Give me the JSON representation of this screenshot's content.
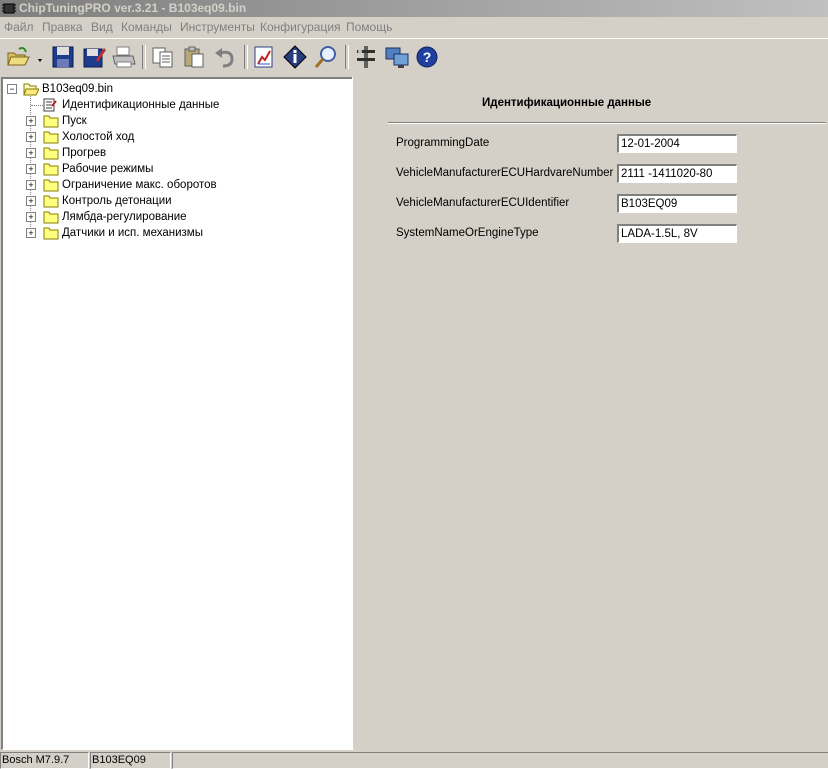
{
  "window": {
    "title": "ChipTuningPRO ver.3.21 - B103eq09.bin"
  },
  "menu": [
    {
      "label": "Файл"
    },
    {
      "label": "Правка"
    },
    {
      "label": "Вид"
    },
    {
      "label": "Команды"
    },
    {
      "label": "Инструменты"
    },
    {
      "label": "Конфигурация"
    },
    {
      "label": "Помощь"
    }
  ],
  "toolbar": {
    "buttons": [
      "open-icon",
      "save-icon",
      "save-as-icon",
      "print-icon",
      "copy-icon",
      "paste-icon",
      "undo-icon",
      "chart-icon",
      "info-icon",
      "search-icon",
      "tools-icon",
      "network-icon",
      "help-icon"
    ]
  },
  "tree": {
    "root": "B103eq09.bin",
    "items": [
      {
        "label": "Идентификационные данные"
      },
      {
        "label": "Пуск"
      },
      {
        "label": "Холостой ход"
      },
      {
        "label": "Прогрев"
      },
      {
        "label": "Рабочие режимы"
      },
      {
        "label": "Ограничение макс. оборотов"
      },
      {
        "label": "Контроль детонации"
      },
      {
        "label": "Лямбда-регулирование"
      },
      {
        "label": "Датчики и исп. механизмы"
      }
    ]
  },
  "detail": {
    "title": "Идентификационные данные",
    "fields": [
      {
        "label": "ProgrammingDate",
        "value": "12-01-2004"
      },
      {
        "label": "VehicleManufacturerECUHardvareNumber",
        "value": "2111 -1411020-80"
      },
      {
        "label": "VehicleManufacturerECUIdentifier",
        "value": "B103EQ09"
      },
      {
        "label": "SystemNameOrEngineType",
        "value": "LADA-1.5L, 8V"
      }
    ]
  },
  "status": {
    "ecu": "Bosch M7.9.7",
    "file": "B103EQ09"
  }
}
